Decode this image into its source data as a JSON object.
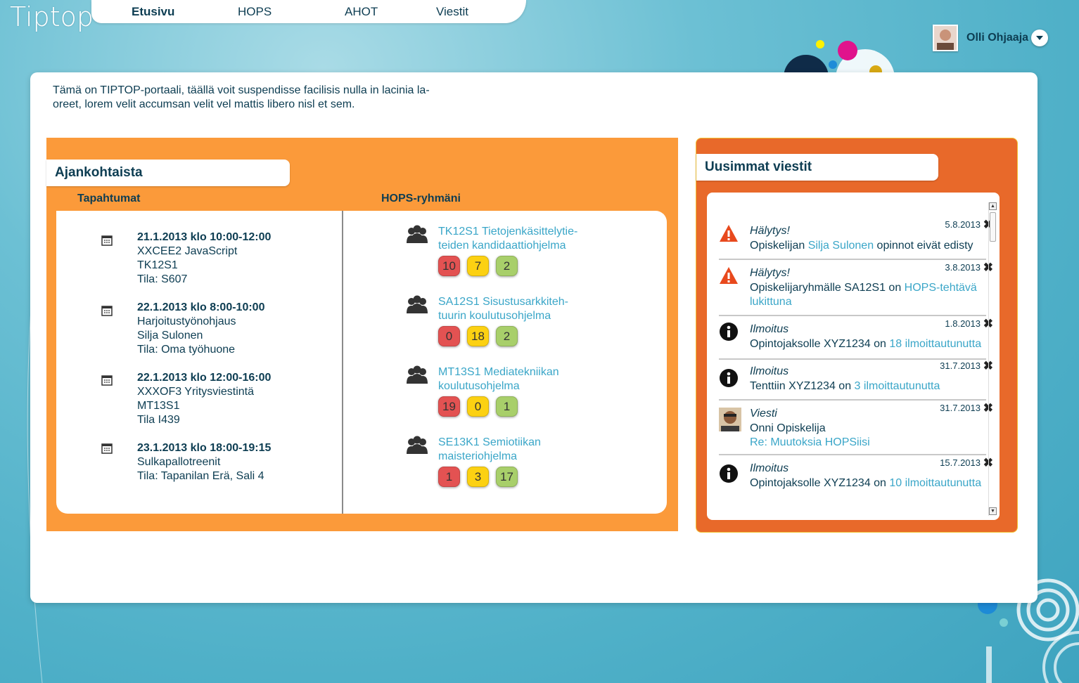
{
  "app": {
    "logo": "Tiptop"
  },
  "nav": {
    "items": [
      {
        "label": "Etusivu",
        "active": true
      },
      {
        "label": "HOPS",
        "active": false
      },
      {
        "label": "AHOT",
        "active": false
      },
      {
        "label": "Viestit",
        "active": false
      }
    ]
  },
  "user": {
    "name": "Olli Ohjaaja"
  },
  "intro": "Tämä on TIPTOP-portaali, täällä voit suspendisse facilisis nulla in lacinia la-\noreet, lorem velit accumsan velit vel mattis libero nisl et sem.",
  "news": {
    "title": "Ajankohtaista",
    "events_heading": "Tapahtumat",
    "groups_heading": "HOPS-ryhmäni",
    "events": [
      {
        "date": "21.1.2013 klo 10:00-12:00",
        "lines": [
          "XXCEE2 JavaScript",
          "TK12S1",
          "Tila: S607"
        ]
      },
      {
        "date": "22.1.2013 klo 8:00-10:00",
        "lines": [
          "Harjoitustyönohjaus",
          "Silja Sulonen",
          "Tila: Oma työhuone"
        ]
      },
      {
        "date": "22.1.2013 klo 12:00-16:00",
        "lines": [
          "XXXOF3 Yritysviestintä",
          "MT13S1",
          "Tila I439"
        ]
      },
      {
        "date": "23.1.2013 klo 18:00-19:15",
        "lines": [
          "Sulkapallotreenit",
          "Tila: Tapanilan Erä, Sali 4"
        ]
      }
    ],
    "groups": [
      {
        "line1": "TK12S1 Tietojenkäsittelytie-",
        "line2": "teiden kandidaattiohjelma",
        "red": "10",
        "yellow": "7",
        "green": "2"
      },
      {
        "line1": "SA12S1 Sisustusarkkiteh-",
        "line2": "tuurin koulutusohjelma",
        "red": "0",
        "yellow": "18",
        "green": "2"
      },
      {
        "line1": "MT13S1 Mediatekniikan",
        "line2": "koulutusohjelma",
        "red": "19",
        "yellow": "0",
        "green": "1"
      },
      {
        "line1": "SE13K1 Semiotiikan",
        "line2": "maisteriohjelma",
        "red": "1",
        "yellow": "3",
        "green": "17"
      }
    ]
  },
  "messages": {
    "title": "Uusimmat viestit",
    "close_glyph": "✖",
    "items": [
      {
        "icon": "warning-icon",
        "type": "Hälytys!",
        "date": "5.8.2013",
        "l1a": "Opiskelijan ",
        "l1link": "Silja Sulonen",
        "l1b": " opinnot eivät edisty",
        "l2link": ""
      },
      {
        "icon": "warning-icon",
        "type": "Hälytys!",
        "date": "3.8.2013",
        "l1a": "Opiskelijaryhmälle SA12S1 on ",
        "l1link": "HOPS-tehtävä",
        "l1b": "",
        "l2link": "lukittuna"
      },
      {
        "icon": "info-icon",
        "type": "Ilmoitus",
        "date": "1.8.2013",
        "l1a": "Opintojaksolle XYZ1234 on ",
        "l1link": "18 ilmoittautunutta",
        "l1b": "",
        "l2link": ""
      },
      {
        "icon": "info-icon",
        "type": "Ilmoitus",
        "date": "31.7.2013",
        "l1a": "Tenttiin XYZ1234 on ",
        "l1link": "3 ilmoittautunutta",
        "l1b": "",
        "l2link": ""
      },
      {
        "icon": "avatar",
        "type": "Viesti",
        "date": "31.7.2013",
        "l1a": "Onni Opiskelija",
        "l1link": "",
        "l1b": "",
        "l2link": "Re: Muutoksia HOPSiisi"
      },
      {
        "icon": "info-icon",
        "type": "Ilmoitus",
        "date": "15.7.2013",
        "l1a": "Opintojaksolle XYZ1234 on ",
        "l1link": "10 ilmoittautunutta",
        "l1b": "",
        "l2link": ""
      }
    ]
  }
}
